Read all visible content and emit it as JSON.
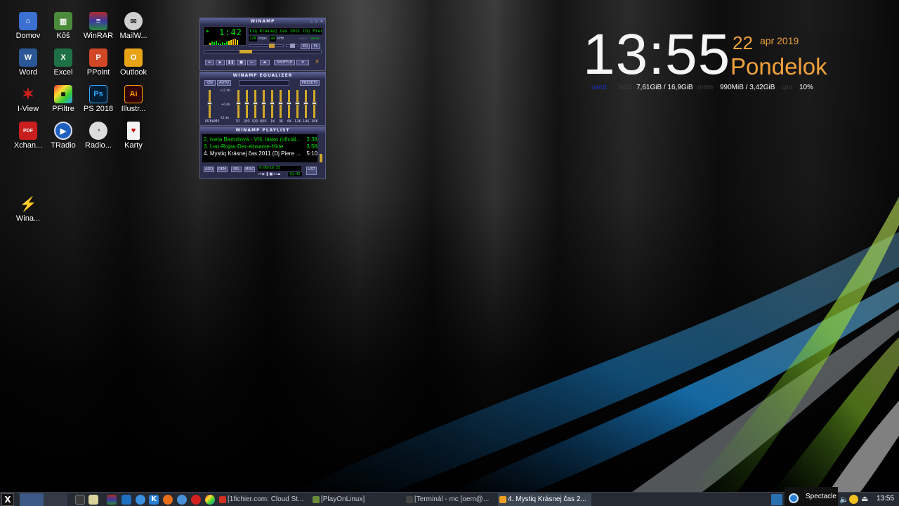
{
  "desktop": {
    "icons": [
      {
        "label": "Domov",
        "icon": "home-folder-icon",
        "color": "#3b6fd0"
      },
      {
        "label": "Kôš",
        "icon": "trash-icon",
        "color": "#4b8b3b"
      },
      {
        "label": "WinRAR",
        "icon": "winrar-icon",
        "color": "#6a3c8a"
      },
      {
        "label": "MailW...",
        "icon": "mail-icon",
        "color": "#8a8a8a"
      },
      {
        "label": "Word",
        "icon": "word-icon",
        "color": "#2b5797"
      },
      {
        "label": "Excel",
        "icon": "excel-icon",
        "color": "#1e7145"
      },
      {
        "label": "PPoint",
        "icon": "powerpoint-icon",
        "color": "#d24726"
      },
      {
        "label": "Outlook",
        "icon": "outlook-icon",
        "color": "#e8a317"
      },
      {
        "label": "I-View",
        "icon": "irfanview-icon",
        "color": "#c0201a"
      },
      {
        "label": "PFiltre",
        "icon": "pfiltre-icon",
        "color": "#333333"
      },
      {
        "label": "PS 2018",
        "icon": "photoshop-icon",
        "color": "#001d34"
      },
      {
        "label": "Illustr...",
        "icon": "illustrator-icon",
        "color": "#330000"
      },
      {
        "label": "Xchan...",
        "icon": "pdf-xchange-icon",
        "color": "#c81e1e"
      },
      {
        "label": "TRadio",
        "icon": "tradio-icon",
        "color": "#1f5fbf"
      },
      {
        "label": "Radio...",
        "icon": "radio-icon",
        "color": "#dddddd"
      },
      {
        "label": "Karty",
        "icon": "cards-icon",
        "color": "#f4f4f4"
      },
      {
        "label": "Wina...",
        "icon": "winamp-icon",
        "color": "#f0a020"
      }
    ]
  },
  "clock": {
    "time": "13:55",
    "day": "22",
    "month_year": "apr 2019",
    "weekday": "Pondelok",
    "used_label": "used",
    "hdd_label": "hdd",
    "hdd_value": "7,61GiB / 16,9GiB",
    "mem_label": "mem",
    "mem_value": "990MiB / 3,42GiB",
    "cpu_label": "cpu",
    "cpu_value": "10%"
  },
  "winamp": {
    "main_title": "WINAMP",
    "time": "1:42",
    "track_scroll": "tiq Krásnej čas 2011 (Dj Piere D",
    "kbps": "128",
    "kbps_label": "kbps",
    "khz": "44",
    "khz_label": "kHz",
    "mono": "mono",
    "stereo": "stereo",
    "shuffle": "SHUFFLE",
    "eq_btn": "EQ",
    "pl_btn": "PL",
    "eq_title": "WINAMP EQUALIZER",
    "eq_on": "ON",
    "eq_auto": "AUTO",
    "eq_presets": "PRESETS",
    "eq_db_top": "+12 db",
    "eq_db_mid": "+0 db",
    "eq_db_bot": "-12 db",
    "eq_preamp": "PREAMP",
    "eq_bands": [
      "70",
      "180",
      "320",
      "600",
      "1K",
      "3K",
      "6K",
      "12K",
      "14K",
      "16K"
    ],
    "pl_title": "WINAMP PLAYLIST",
    "playlist": [
      {
        "title": "2. Iveta Bartošová - Víš, lásko (oficiál...",
        "dur": "3:38",
        "color": "#00e000"
      },
      {
        "title": "3. Leo-Rojas-Der-einsame-Hirte",
        "dur": "3:58",
        "color": "#00e000"
      },
      {
        "title": "4. Mystiq Krásnej čas 2011 (Dj Piere ...",
        "dur": "5:10",
        "color": "#ffffff"
      }
    ],
    "pl_add": "ADD",
    "pl_rem": "REM",
    "pl_sel": "SEL",
    "pl_misc": "MISC",
    "pl_list": "LIST",
    "pl_total": "0:00/16:55",
    "pl_time": "01:42"
  },
  "taskbar": {
    "tasks": [
      {
        "label": "[1fichier.com: Cloud St...",
        "icon_color": "#d03020"
      },
      {
        "label": "[PlayOnLinux]",
        "icon_color": "#6a8a3a"
      },
      {
        "label": "[Terminál - mc [oem@...",
        "icon_color": "#444444"
      },
      {
        "label": "4. Mystiq Krásnej čas 2...",
        "icon_color": "#f0a020"
      }
    ],
    "tray_tooltip": "Spectacle",
    "tray_time": "13:55"
  }
}
